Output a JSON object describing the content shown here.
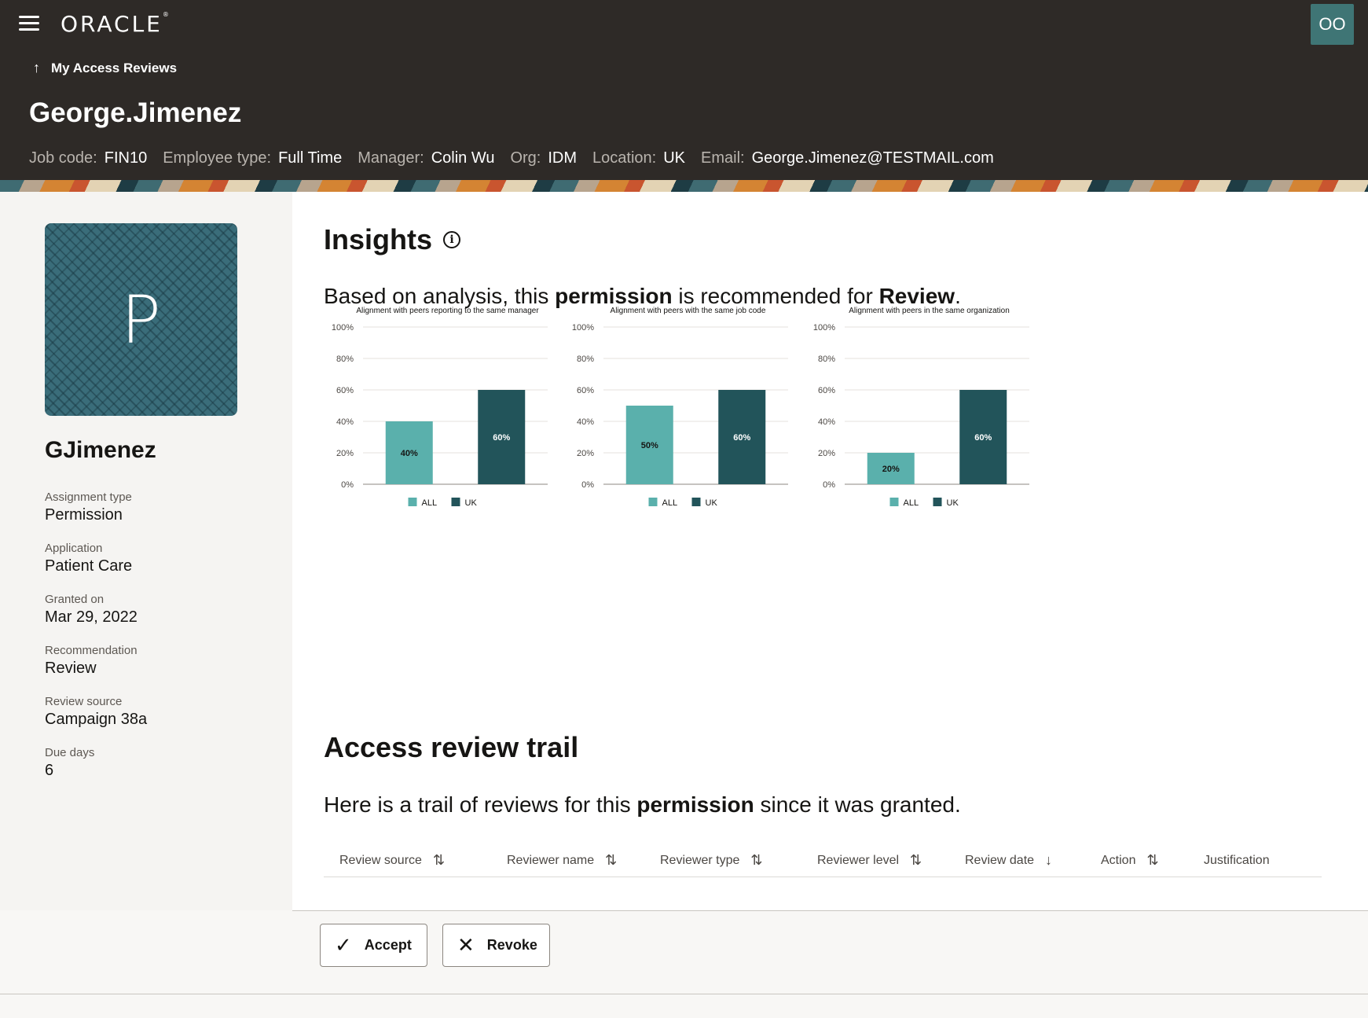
{
  "header": {
    "logo": "ORACLE",
    "user_initials": "OO",
    "back_label": "My Access Reviews",
    "person_name": "George.Jimenez",
    "meta": [
      {
        "label": "Job code:",
        "value": "FIN10"
      },
      {
        "label": "Employee type:",
        "value": "Full Time"
      },
      {
        "label": "Manager:",
        "value": "Colin Wu"
      },
      {
        "label": "Org:",
        "value": "IDM"
      },
      {
        "label": "Location:",
        "value": "UK"
      },
      {
        "label": "Email:",
        "value": "George.Jimenez@TESTMAIL.com"
      }
    ]
  },
  "profile": {
    "avatar_letter": "P",
    "username": "GJimenez",
    "details": [
      {
        "label": "Assignment type",
        "value": "Permission"
      },
      {
        "label": "Application",
        "value": "Patient Care"
      },
      {
        "label": "Granted on",
        "value": "Mar 29, 2022"
      },
      {
        "label": "Recommendation",
        "value": "Review"
      },
      {
        "label": "Review source",
        "value": "Campaign 38a"
      },
      {
        "label": "Due days",
        "value": "6"
      }
    ]
  },
  "insights": {
    "title": "Insights",
    "sentence_pre": "Based on analysis, this ",
    "sentence_b1": "permission",
    "sentence_mid": " is recommended for ",
    "sentence_b2": "Review",
    "sentence_post": "."
  },
  "chart_data": [
    {
      "type": "bar",
      "title": "Alignment with peers reporting to the same manager",
      "categories": [
        "ALL",
        "UK"
      ],
      "values": [
        40,
        60
      ],
      "data_labels": [
        "40%",
        "60%"
      ],
      "ylim": [
        0,
        100
      ],
      "yticks": [
        "0%",
        "20%",
        "40%",
        "60%",
        "80%",
        "100%"
      ],
      "legend": [
        "ALL",
        "UK"
      ],
      "legend_position": "bottom",
      "colors": [
        "#5ab0ac",
        "#22545a"
      ]
    },
    {
      "type": "bar",
      "title": "Alignment with peers with the same job code",
      "categories": [
        "ALL",
        "UK"
      ],
      "values": [
        50,
        60
      ],
      "data_labels": [
        "50%",
        "60%"
      ],
      "ylim": [
        0,
        100
      ],
      "yticks": [
        "0%",
        "20%",
        "40%",
        "60%",
        "80%",
        "100%"
      ],
      "legend": [
        "ALL",
        "UK"
      ],
      "legend_position": "bottom",
      "colors": [
        "#5ab0ac",
        "#22545a"
      ]
    },
    {
      "type": "bar",
      "title": "Alignment with peers in the same organization",
      "categories": [
        "ALL",
        "UK"
      ],
      "values": [
        20,
        60
      ],
      "data_labels": [
        "20%",
        "60%"
      ],
      "ylim": [
        0,
        100
      ],
      "yticks": [
        "0%",
        "20%",
        "40%",
        "60%",
        "80%",
        "100%"
      ],
      "legend": [
        "ALL",
        "UK"
      ],
      "legend_position": "bottom",
      "colors": [
        "#5ab0ac",
        "#22545a"
      ]
    }
  ],
  "trail": {
    "title": "Access review trail",
    "sentence_pre": "Here is a trail of reviews for this ",
    "sentence_b": "permission",
    "sentence_post": " since it was granted.",
    "columns": [
      {
        "label": "Review source",
        "sort": "both"
      },
      {
        "label": "Reviewer name",
        "sort": "both"
      },
      {
        "label": "Reviewer type",
        "sort": "both"
      },
      {
        "label": "Reviewer level",
        "sort": "both"
      },
      {
        "label": "Review date",
        "sort": "desc"
      },
      {
        "label": "Action",
        "sort": "both"
      },
      {
        "label": "Justification",
        "sort": "none"
      }
    ]
  },
  "actions": {
    "accept_label": "Accept",
    "revoke_label": "Revoke"
  }
}
